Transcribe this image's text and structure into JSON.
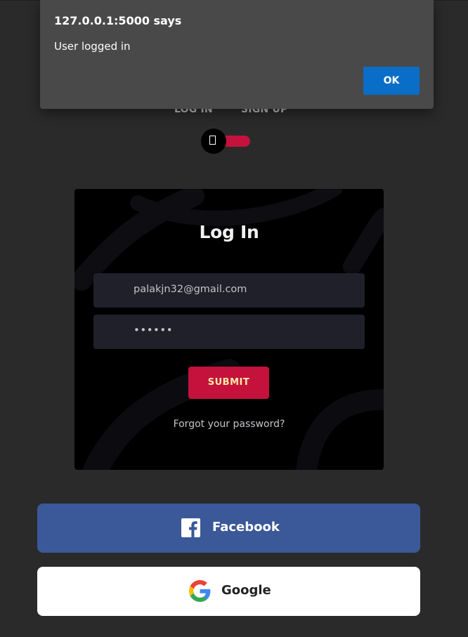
{
  "alert": {
    "origin": "127.0.0.1:5000 says",
    "message": "User logged in",
    "ok_label": "OK"
  },
  "tabs": {
    "login_label": "LOG IN",
    "signup_label": "SIGN UP"
  },
  "toggle": {
    "icon": "rectangle-icon",
    "checked": false
  },
  "login_card": {
    "title": "Log In",
    "email_value": "palakjn32@gmail.com",
    "password_value": "••••••",
    "submit_label": "SUBMIT",
    "forgot_label": "Forgot your password?"
  },
  "social": {
    "facebook_label": "Facebook",
    "google_label": "Google"
  },
  "colors": {
    "page_bg": "#2a2a2a",
    "card_bg": "#000000",
    "field_bg": "#1f2029",
    "accent": "#c4123d",
    "submit_text": "#ffeba7",
    "facebook": "#3b5998",
    "google_bg": "#ffffff",
    "alert_bg": "#494949",
    "alert_ok": "#0a6ec8"
  }
}
